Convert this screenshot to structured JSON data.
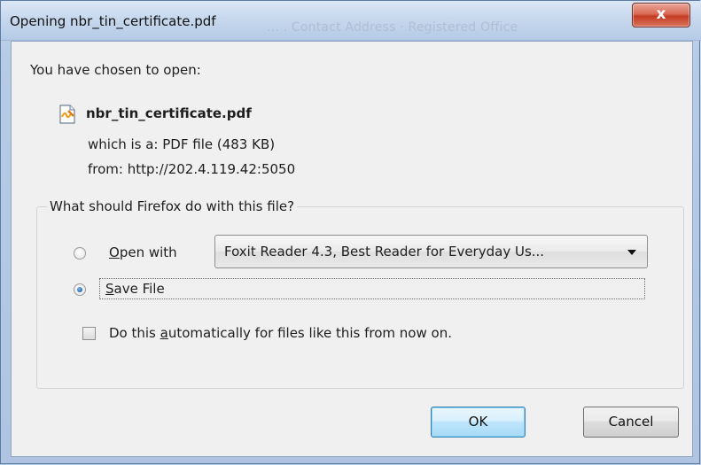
{
  "window": {
    "title": "Opening nbr_tin_certificate.pdf",
    "close_glyph": "x",
    "background_text": "... . Contact Address · Registered Office"
  },
  "dialog": {
    "intro": "You have chosen to open:",
    "file_name": "nbr_tin_certificate.pdf",
    "file_icon": "pdf-file-icon",
    "which_label": "which is a:",
    "which_value": "PDF file (483 KB)",
    "from_label": "from:",
    "from_value": "http://202.4.119.42:5050",
    "question": "What should Firefox do with this file?",
    "open_with": {
      "label_accel": "O",
      "label_rest": "pen with",
      "selected": false,
      "app_value": "Foxit Reader 4.3, Best Reader for Everyday Us..."
    },
    "save_file": {
      "label_accel": "S",
      "label_rest": "ave File",
      "selected": true
    },
    "auto": {
      "label_pre": "Do this ",
      "label_accel": "a",
      "label_post": "utomatically for files like this from now on.",
      "checked": false
    },
    "buttons": {
      "ok": "OK",
      "cancel": "Cancel"
    }
  },
  "colors": {
    "title_bar": "#c7d8ee",
    "close_red": "#c43b22",
    "dialog_bg": "#f0f0f0",
    "ok_focus": "#3c7fb1"
  }
}
